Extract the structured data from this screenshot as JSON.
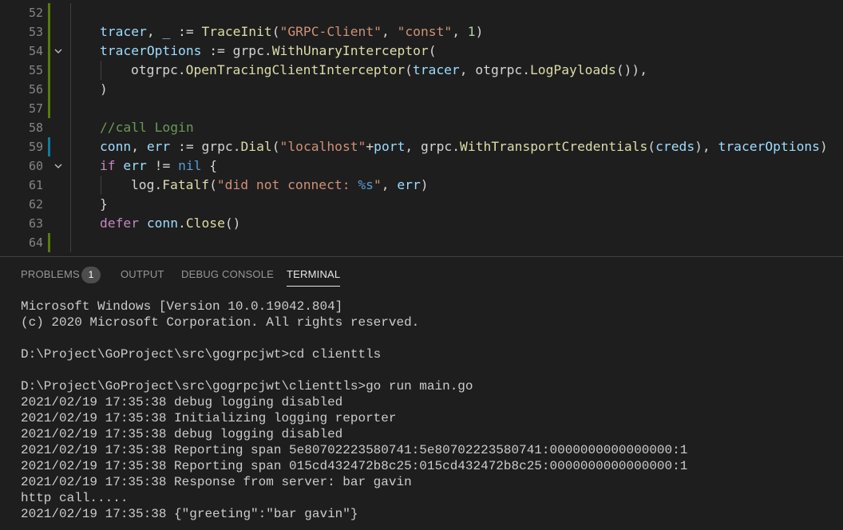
{
  "editor": {
    "top_partial": "}",
    "lines": [
      {
        "num": "52",
        "gutter": "added",
        "fold": "",
        "guide2": false,
        "indent": 1,
        "segments": []
      },
      {
        "num": "53",
        "gutter": "added",
        "fold": "",
        "guide2": false,
        "indent": 1,
        "segments": [
          {
            "t": "tracer",
            "c": "t-var"
          },
          {
            "t": ", ",
            "c": ""
          },
          {
            "t": "_",
            "c": "t-var"
          },
          {
            "t": " := ",
            "c": ""
          },
          {
            "t": "TraceInit",
            "c": "t-fn"
          },
          {
            "t": "(",
            "c": ""
          },
          {
            "t": "\"GRPC-Client\"",
            "c": "t-str"
          },
          {
            "t": ", ",
            "c": ""
          },
          {
            "t": "\"const\"",
            "c": "t-str"
          },
          {
            "t": ", ",
            "c": ""
          },
          {
            "t": "1",
            "c": "t-num"
          },
          {
            "t": ")",
            "c": ""
          }
        ]
      },
      {
        "num": "54",
        "gutter": "added",
        "fold": "chevron-down",
        "guide2": false,
        "indent": 1,
        "segments": [
          {
            "t": "tracerOptions",
            "c": "t-var"
          },
          {
            "t": " := ",
            "c": ""
          },
          {
            "t": "grpc",
            "c": ""
          },
          {
            "t": ".",
            "c": ""
          },
          {
            "t": "WithUnaryInterceptor",
            "c": "t-fn"
          },
          {
            "t": "(",
            "c": ""
          }
        ]
      },
      {
        "num": "55",
        "gutter": "added",
        "fold": "",
        "guide2": true,
        "indent": 2,
        "segments": [
          {
            "t": "otgrpc",
            "c": ""
          },
          {
            "t": ".",
            "c": ""
          },
          {
            "t": "OpenTracingClientInterceptor",
            "c": "t-fn"
          },
          {
            "t": "(",
            "c": ""
          },
          {
            "t": "tracer",
            "c": "t-var"
          },
          {
            "t": ", ",
            "c": ""
          },
          {
            "t": "otgrpc",
            "c": ""
          },
          {
            "t": ".",
            "c": ""
          },
          {
            "t": "LogPayloads",
            "c": "t-fn"
          },
          {
            "t": "()),",
            "c": ""
          }
        ]
      },
      {
        "num": "56",
        "gutter": "added",
        "fold": "",
        "guide2": false,
        "indent": 1,
        "segments": [
          {
            "t": ")",
            "c": ""
          }
        ]
      },
      {
        "num": "57",
        "gutter": "added",
        "fold": "",
        "guide2": false,
        "indent": 1,
        "segments": []
      },
      {
        "num": "58",
        "gutter": "",
        "fold": "",
        "guide2": false,
        "indent": 1,
        "segments": [
          {
            "t": "//call Login",
            "c": "t-com"
          }
        ]
      },
      {
        "num": "59",
        "gutter": "modified",
        "fold": "",
        "guide2": false,
        "indent": 1,
        "segments": [
          {
            "t": "conn",
            "c": "t-var"
          },
          {
            "t": ", ",
            "c": ""
          },
          {
            "t": "err",
            "c": "t-var"
          },
          {
            "t": " := ",
            "c": ""
          },
          {
            "t": "grpc",
            "c": ""
          },
          {
            "t": ".",
            "c": ""
          },
          {
            "t": "Dial",
            "c": "t-fn"
          },
          {
            "t": "(",
            "c": ""
          },
          {
            "t": "\"localhost\"",
            "c": "t-str"
          },
          {
            "t": "+",
            "c": ""
          },
          {
            "t": "port",
            "c": "t-var"
          },
          {
            "t": ", ",
            "c": ""
          },
          {
            "t": "grpc",
            "c": ""
          },
          {
            "t": ".",
            "c": ""
          },
          {
            "t": "WithTransportCredentials",
            "c": "t-fn"
          },
          {
            "t": "(",
            "c": ""
          },
          {
            "t": "creds",
            "c": "t-var"
          },
          {
            "t": "), ",
            "c": ""
          },
          {
            "t": "tracerOptions",
            "c": "t-var"
          },
          {
            "t": ")",
            "c": ""
          }
        ]
      },
      {
        "num": "60",
        "gutter": "",
        "fold": "chevron-down",
        "guide2": false,
        "indent": 1,
        "segments": [
          {
            "t": "if",
            "c": "t-kw"
          },
          {
            "t": " ",
            "c": ""
          },
          {
            "t": "err",
            "c": "t-var"
          },
          {
            "t": " != ",
            "c": ""
          },
          {
            "t": "nil",
            "c": "t-blue"
          },
          {
            "t": " {",
            "c": ""
          }
        ]
      },
      {
        "num": "61",
        "gutter": "",
        "fold": "",
        "guide2": true,
        "indent": 2,
        "segments": [
          {
            "t": "log",
            "c": ""
          },
          {
            "t": ".",
            "c": ""
          },
          {
            "t": "Fatalf",
            "c": "t-fn"
          },
          {
            "t": "(",
            "c": ""
          },
          {
            "t": "\"did not connect: ",
            "c": "t-str"
          },
          {
            "t": "%s",
            "c": "t-blue"
          },
          {
            "t": "\"",
            "c": "t-str"
          },
          {
            "t": ", ",
            "c": ""
          },
          {
            "t": "err",
            "c": "t-var"
          },
          {
            "t": ")",
            "c": ""
          }
        ]
      },
      {
        "num": "62",
        "gutter": "",
        "fold": "",
        "guide2": false,
        "indent": 1,
        "segments": [
          {
            "t": "}",
            "c": ""
          }
        ]
      },
      {
        "num": "63",
        "gutter": "",
        "fold": "",
        "guide2": false,
        "indent": 1,
        "segments": [
          {
            "t": "defer",
            "c": "t-kw"
          },
          {
            "t": " ",
            "c": ""
          },
          {
            "t": "conn",
            "c": "t-var"
          },
          {
            "t": ".",
            "c": ""
          },
          {
            "t": "Close",
            "c": "t-fn"
          },
          {
            "t": "()",
            "c": ""
          }
        ]
      },
      {
        "num": "64",
        "gutter": "added",
        "fold": "",
        "guide2": false,
        "indent": 1,
        "segments": []
      }
    ]
  },
  "panel": {
    "tabs": [
      {
        "label": "PROBLEMS",
        "badge": "1",
        "active": false
      },
      {
        "label": "OUTPUT",
        "active": false
      },
      {
        "label": "DEBUG CONSOLE",
        "active": false
      },
      {
        "label": "TERMINAL",
        "active": true
      }
    ]
  },
  "terminal": {
    "lines": [
      "Microsoft Windows [Version 10.0.19042.804]",
      "(c) 2020 Microsoft Corporation. All rights reserved.",
      "",
      "D:\\Project\\GoProject\\src\\gogrpcjwt>cd clienttls",
      "",
      "D:\\Project\\GoProject\\src\\gogrpcjwt\\clienttls>go run main.go",
      "2021/02/19 17:35:38 debug logging disabled",
      "2021/02/19 17:35:38 Initializing logging reporter",
      "2021/02/19 17:35:38 debug logging disabled",
      "2021/02/19 17:35:38 Reporting span 5e80702223580741:5e80702223580741:0000000000000000:1",
      "2021/02/19 17:35:38 Reporting span 015cd432472b8c25:015cd432472b8c25:0000000000000000:1",
      "2021/02/19 17:35:38 Response from server: bar gavin",
      "http call.....",
      "2021/02/19 17:35:38 {\"greeting\":\"bar gavin\"}"
    ]
  }
}
